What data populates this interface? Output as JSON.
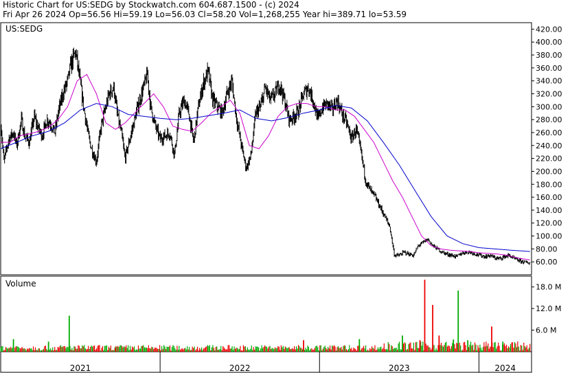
{
  "header": {
    "line1": "Historic Chart for US:SEDG by Stockwatch.com 604.687.1500 - (c) 2024",
    "line2": "Fri Apr 26 2024   Op=56.56   Hi=59.19   Lo=56.03   Cl=58.20   Vol=1,268,255   Year hi=389.71   lo=53.59"
  },
  "chart_data": [
    {
      "type": "line",
      "panel": "price",
      "title": "US:SEDG",
      "ylim": [
        40,
        430
      ],
      "yticks": [
        "60.00",
        "80.00",
        "100.00",
        "120.00",
        "140.00",
        "160.00",
        "180.00",
        "200.00",
        "220.00",
        "240.00",
        "260.00",
        "280.00",
        "300.00",
        "320.00",
        "340.00",
        "360.00",
        "380.00",
        "400.00",
        "420.00"
      ],
      "xlim": [
        2021.0,
        2024.33
      ],
      "x_labels": [
        "2021",
        "2022",
        "2023",
        "2024"
      ],
      "colors": {
        "price": "#000000",
        "ma_short": "#cc00cc",
        "ma_long": "#0000cc"
      },
      "series": [
        {
          "role": "price",
          "x": [
            2021.0,
            2021.02,
            2021.05,
            2021.08,
            2021.1,
            2021.13,
            2021.15,
            2021.18,
            2021.21,
            2021.23,
            2021.26,
            2021.29,
            2021.31,
            2021.34,
            2021.36,
            2021.39,
            2021.42,
            2021.44,
            2021.47,
            2021.5,
            2021.52,
            2021.55,
            2021.57,
            2021.6,
            2021.63,
            2021.65,
            2021.68,
            2021.71,
            2021.73,
            2021.76,
            2021.78,
            2021.81,
            2021.84,
            2021.86,
            2021.89,
            2021.92,
            2021.94,
            2021.97,
            2022.0,
            2022.03,
            2022.06,
            2022.09,
            2022.12,
            2022.15,
            2022.18,
            2022.21,
            2022.24,
            2022.27,
            2022.3,
            2022.33,
            2022.36,
            2022.39,
            2022.42,
            2022.45,
            2022.48,
            2022.51,
            2022.54,
            2022.57,
            2022.6,
            2022.63,
            2022.66,
            2022.69,
            2022.72,
            2022.75,
            2022.78,
            2022.81,
            2022.84,
            2022.87,
            2022.9,
            2022.93,
            2022.96,
            2022.99,
            2023.02,
            2023.05,
            2023.08,
            2023.11,
            2023.14,
            2023.17,
            2023.2,
            2023.23,
            2023.26,
            2023.29,
            2023.32,
            2023.35,
            2023.38,
            2023.41,
            2023.44,
            2023.47,
            2023.5,
            2023.53,
            2023.56,
            2023.59,
            2023.62,
            2023.65,
            2023.68,
            2023.71,
            2023.74,
            2023.77,
            2023.8,
            2023.83,
            2023.86,
            2023.89,
            2023.92,
            2023.95,
            2023.98,
            2024.01,
            2024.04,
            2024.07,
            2024.1,
            2024.13,
            2024.16,
            2024.19,
            2024.22,
            2024.25,
            2024.28,
            2024.32
          ],
          "values": [
            275,
            215,
            250,
            260,
            240,
            280,
            255,
            245,
            285,
            270,
            255,
            280,
            275,
            260,
            290,
            320,
            340,
            365,
            385,
            335,
            300,
            255,
            235,
            215,
            270,
            290,
            320,
            330,
            290,
            255,
            220,
            250,
            280,
            300,
            325,
            350,
            300,
            270,
            250,
            255,
            260,
            225,
            290,
            310,
            290,
            245,
            300,
            335,
            355,
            310,
            300,
            290,
            320,
            340,
            280,
            240,
            205,
            225,
            290,
            300,
            330,
            310,
            320,
            335,
            310,
            280,
            285,
            295,
            320,
            330,
            310,
            280,
            300,
            305,
            295,
            310,
            290,
            275,
            250,
            265,
            230,
            185,
            170,
            160,
            145,
            130,
            115,
            70,
            70,
            75,
            72,
            70,
            85,
            90,
            95,
            85,
            80,
            75,
            72,
            70,
            68,
            73,
            75,
            75,
            72,
            70,
            68,
            70,
            66,
            65,
            68,
            70,
            65,
            62,
            60,
            58
          ]
        },
        {
          "role": "ma_short",
          "x": [
            2021.0,
            2021.06,
            2021.12,
            2021.18,
            2021.24,
            2021.3,
            2021.36,
            2021.42,
            2021.48,
            2021.54,
            2021.6,
            2021.66,
            2021.72,
            2021.78,
            2021.84,
            2021.9,
            2021.96,
            2022.02,
            2022.08,
            2022.14,
            2022.2,
            2022.26,
            2022.32,
            2022.38,
            2022.44,
            2022.5,
            2022.56,
            2022.62,
            2022.68,
            2022.74,
            2022.8,
            2022.86,
            2022.92,
            2022.98,
            2023.04,
            2023.1,
            2023.16,
            2023.22,
            2023.28,
            2023.34,
            2023.4,
            2023.46,
            2023.52,
            2023.58,
            2023.64,
            2023.7,
            2023.76,
            2023.82,
            2023.88,
            2023.94,
            2024.0,
            2024.06,
            2024.12,
            2024.18,
            2024.24,
            2024.32
          ],
          "values": [
            245,
            245,
            255,
            258,
            262,
            268,
            280,
            300,
            340,
            350,
            320,
            275,
            265,
            275,
            290,
            305,
            320,
            300,
            270,
            265,
            262,
            275,
            290,
            300,
            310,
            290,
            240,
            235,
            255,
            285,
            300,
            305,
            305,
            300,
            300,
            295,
            295,
            285,
            265,
            245,
            215,
            185,
            160,
            130,
            100,
            85,
            80,
            78,
            77,
            76,
            74,
            73,
            72,
            70,
            66,
            63
          ]
        },
        {
          "role": "ma_long",
          "x": [
            2021.0,
            2021.1,
            2021.2,
            2021.3,
            2021.4,
            2021.5,
            2021.6,
            2021.7,
            2021.8,
            2021.9,
            2022.0,
            2022.1,
            2022.2,
            2022.3,
            2022.4,
            2022.5,
            2022.6,
            2022.7,
            2022.8,
            2022.9,
            2023.0,
            2023.1,
            2023.2,
            2023.3,
            2023.4,
            2023.5,
            2023.6,
            2023.7,
            2023.8,
            2023.9,
            2024.0,
            2024.1,
            2024.2,
            2024.32
          ],
          "values": [
            235,
            245,
            255,
            262,
            275,
            295,
            305,
            300,
            288,
            285,
            282,
            280,
            282,
            286,
            290,
            295,
            282,
            278,
            283,
            290,
            295,
            302,
            298,
            278,
            245,
            210,
            170,
            130,
            100,
            88,
            82,
            80,
            78,
            76
          ]
        }
      ]
    },
    {
      "type": "bar",
      "panel": "volume",
      "title": "Volume",
      "ylim": [
        0,
        21
      ],
      "yticks": [
        "6.0 M",
        "12.0 M",
        "18.0 M"
      ],
      "xlim": [
        2021.0,
        2024.33
      ],
      "colors": {
        "up": "#00aa00",
        "down": "#ee0000"
      },
      "x": [
        2021.08,
        2021.3,
        2021.43,
        2021.72,
        2022.9,
        2023.25,
        2023.52,
        2023.63,
        2023.66,
        2023.71,
        2023.75,
        2023.84,
        2023.87,
        2023.93,
        2024.08,
        2024.15
      ],
      "values": [
        3.5,
        2.8,
        10,
        1,
        3.2,
        3.5,
        4.5,
        3.2,
        20,
        13,
        4.5,
        3.4,
        17,
        3.2,
        7,
        2.8
      ],
      "directions": [
        "up",
        "up",
        "up",
        "down",
        "down",
        "up",
        "up",
        "down",
        "down",
        "down",
        "down",
        "up",
        "up",
        "up",
        "down",
        "up"
      ],
      "baseline": {
        "min": 0.3,
        "max": 1.9,
        "up_ratio": 0.45
      }
    }
  ]
}
